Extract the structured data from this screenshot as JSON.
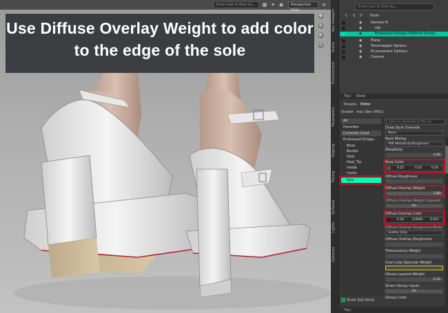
{
  "banner": {
    "line1": "Use Diffuse Overlay Weight to add color",
    "line2": "to the edge of the sole"
  },
  "viewport": {
    "filter_placeholder": "Enter text to filter by...",
    "view_label": "Perspective View",
    "icons": [
      "grid-icon",
      "lights-icon",
      "camera-icon",
      "menu-icon"
    ]
  },
  "scene_pane": {
    "filter_placeholder": "Enter text to filter by...",
    "headers": [
      "C",
      "S",
      "V",
      "Node"
    ],
    "nodes": [
      {
        "name": "Genesis 8",
        "swatch": "#333333",
        "selected": false
      },
      {
        "name": "Hip",
        "swatch": "#333333",
        "selected": false
      },
      {
        "name": "Embossed Strappy Platform Pumps",
        "swatch": "#00c8a0",
        "selected": true
      },
      {
        "name": "Plane",
        "swatch": "#333333",
        "selected": false
      },
      {
        "name": "Tonemapper Options",
        "swatch": "#333333",
        "selected": false
      },
      {
        "name": "Environment Options",
        "swatch": "#333333",
        "selected": false
      },
      {
        "name": "Camera",
        "swatch": "#333333",
        "selected": false
      }
    ],
    "tabs": [
      "Tips",
      "Node"
    ]
  },
  "side_tabs": [
    "Aux Viewport",
    "Scene",
    "Environment",
    "Parameters",
    "Shaping",
    "Posing",
    "Surfaces",
    "Lights",
    "Cameras"
  ],
  "surfaces": {
    "tabs": [
      "Presets",
      "Editor"
    ],
    "shader_label": "Shader",
    "shader_value": "Iray Uber (MDL)",
    "list": [
      {
        "label": "All",
        "state": "hl"
      },
      {
        "label": "Favorites",
        "state": ""
      },
      {
        "label": "Currently Used",
        "state": "hl"
      },
      {
        "label": "Embossed Strapp...",
        "state": ""
      },
      {
        "label": "Base",
        "state": ""
      },
      {
        "label": "Buckle",
        "state": ""
      },
      {
        "label": "Heel",
        "state": ""
      },
      {
        "label": "Heel_Tip",
        "state": ""
      },
      {
        "label": "Inside",
        "state": ""
      },
      {
        "label": "Insole",
        "state": ""
      },
      {
        "label": "Sole",
        "state": "sel"
      }
    ],
    "search_placeholder": "Enter an expression to filter by...",
    "props": {
      "draw_style_label": "Draw Style Override",
      "draw_style_value": "None",
      "base_mixing_label": "Base Mixing",
      "base_mixing_value": "PBR Metallicity/Roughness",
      "metallicity_label": "Metallicity",
      "metallicity_value": "0.00",
      "base_color_label": "Base Color",
      "base_color_values": [
        "0.25",
        "0.16",
        "0.16"
      ],
      "base_color_swatch": "#7a4a4a",
      "diffuse_roughness_label": "Diffuse Roughness",
      "diffuse_overlay_weight_label": "Diffuse Overlay Weight",
      "diffuse_overlay_weight_value": "1.00",
      "diffuse_overlay_weight_squared_label": "Diffuse Overlay Weight Squared",
      "on_label": "On",
      "diffuse_overlay_color_label": "Diffuse Overlay Color",
      "diffuse_overlay_color_values": [
        "0.16",
        "0.0005",
        "0.021"
      ],
      "diffuse_overlay_color_swatch": "#6a0010",
      "diffuse_overlay_roughness_mode_label": "Diffuse Overlay Roughness Mode",
      "scatter_value": "Scatter Only",
      "diffuse_overlay_roughness_label": "Diffuse Overlay Roughness",
      "translucency_weight_label": "Translucency Weight",
      "dual_lobe_label": "Dual Lobe Specular Weight",
      "glossy_layered_label": "Glossy Layered Weight",
      "glossy_layered_value": "0.33",
      "share_glossy_label": "Share Glossy Inputs",
      "share_glossy_value": "On",
      "glossy_color_label": "Glossy Color"
    },
    "show_sub_items": "Show Sub Items"
  },
  "bottom_tab": "Tips",
  "colors": {
    "highlight_box": "#c0102a",
    "selected_row": "#00ffb0"
  }
}
